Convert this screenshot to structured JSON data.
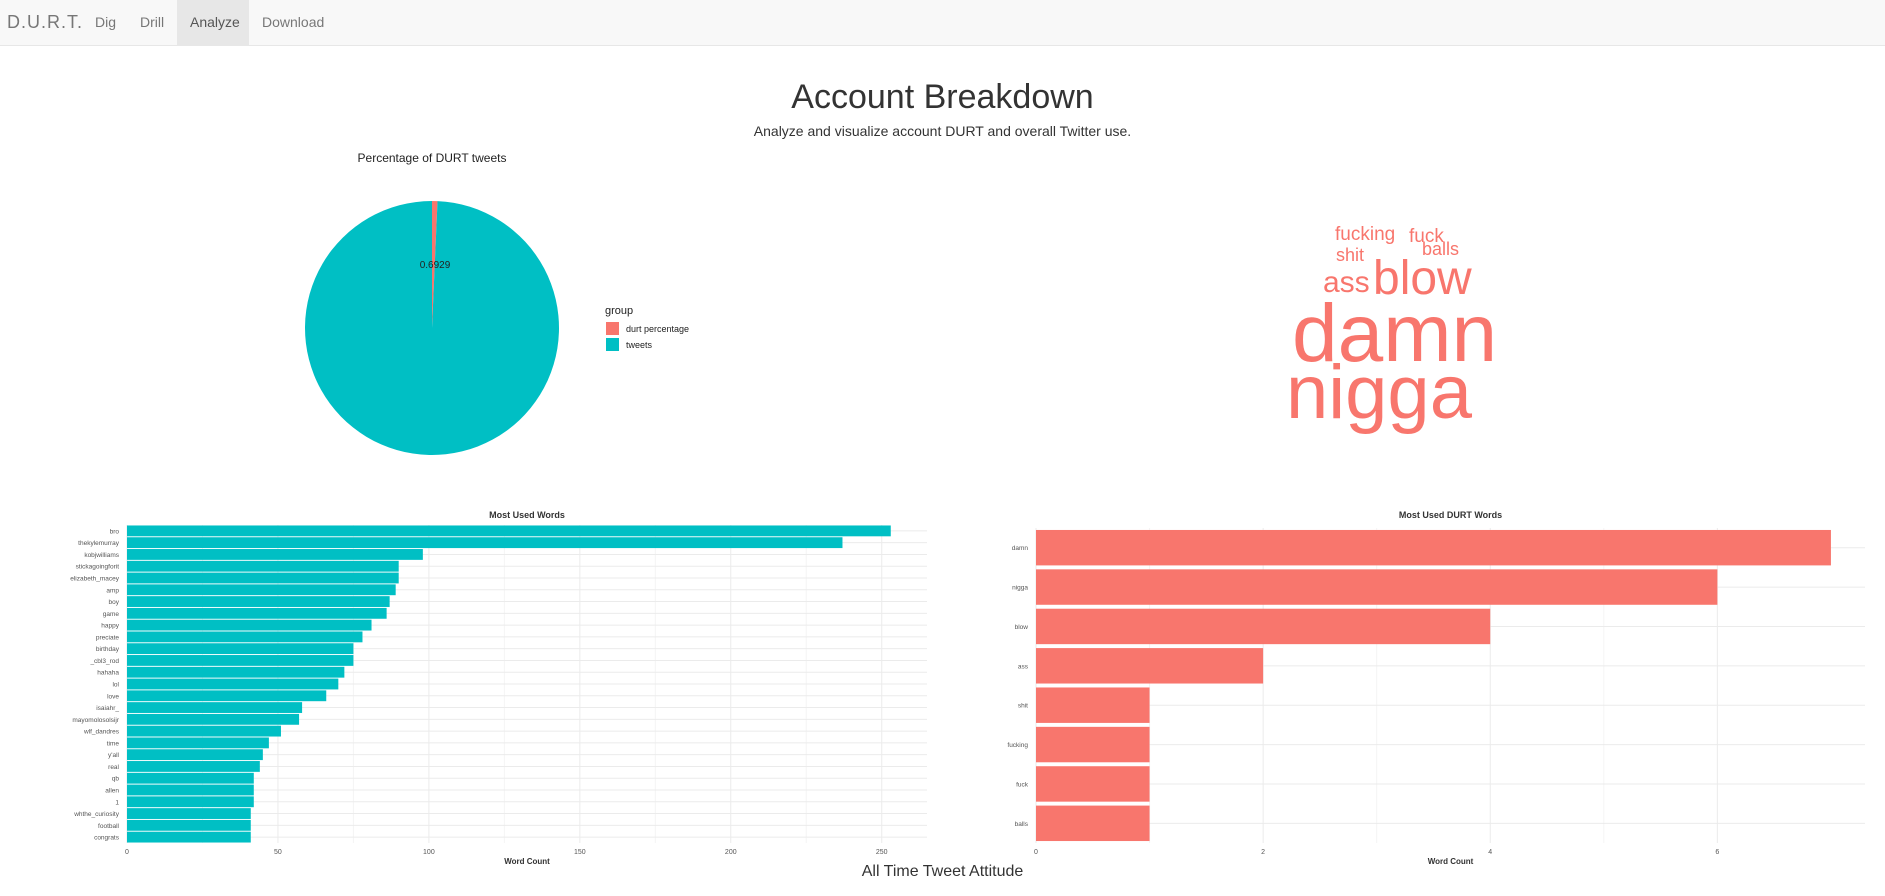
{
  "nav": {
    "brand": "D.U.R.T.",
    "items": [
      "Dig",
      "Drill",
      "Analyze",
      "Download"
    ],
    "active": "Analyze"
  },
  "header": {
    "title": "Account Breakdown",
    "subtitle": "Analyze and visualize account DURT and overall Twitter use."
  },
  "wordcloud": {
    "words": [
      "fucking",
      "fuck",
      "shit",
      "balls",
      "ass",
      "blow",
      "damn",
      "nigga"
    ],
    "color": "#f8766d"
  },
  "footer": {
    "title": "All Time Tweet Attitude"
  },
  "chart_data": [
    {
      "type": "pie",
      "title": "Percentage of DURT tweets",
      "legend_title": "group",
      "legend_position": "right",
      "slices": [
        {
          "label": "durt percentage",
          "value": 0.6929,
          "color": "#f8766d"
        },
        {
          "label": "tweets",
          "value": 99.3071,
          "color": "#00bfc4"
        }
      ],
      "annotation": "0.6929"
    },
    {
      "type": "bar",
      "orientation": "horizontal",
      "title": "Most Used Words",
      "xlabel": "Word Count",
      "xlim": [
        0,
        265
      ],
      "xticks": [
        0,
        50,
        100,
        150,
        200,
        250
      ],
      "color": "#00bfc4",
      "categories": [
        "bro",
        "thekylemurray",
        "kobjwilliams",
        "stickagoingforit",
        "elizabeth_macey",
        "amp",
        "boy",
        "game",
        "happy",
        "preciate",
        "birthday",
        "_cbl3_rod",
        "hahaha",
        "lol",
        "love",
        "isaiahr_",
        "mayomolosolsijr",
        "wlf_dandres",
        "time",
        "y'all",
        "real",
        "qb",
        "allen",
        "1",
        "whthe_curiosity",
        "football",
        "congrats"
      ],
      "values": [
        253,
        237,
        98,
        90,
        90,
        89,
        87,
        86,
        81,
        78,
        75,
        75,
        72,
        70,
        66,
        58,
        57,
        51,
        47,
        45,
        44,
        42,
        42,
        42,
        41,
        41,
        41
      ],
      "grid": true
    },
    {
      "type": "bar",
      "orientation": "horizontal",
      "title": "Most Used DURT Words",
      "xlabel": "Word Count",
      "xlim": [
        0,
        7.3
      ],
      "xticks": [
        0,
        2,
        4,
        6
      ],
      "color": "#f8766d",
      "categories": [
        "damn",
        "nigga",
        "blow",
        "ass",
        "shit",
        "fucking",
        "fuck",
        "balls"
      ],
      "values": [
        7,
        6,
        4,
        2,
        1,
        1,
        1,
        1
      ],
      "grid": true
    }
  ]
}
